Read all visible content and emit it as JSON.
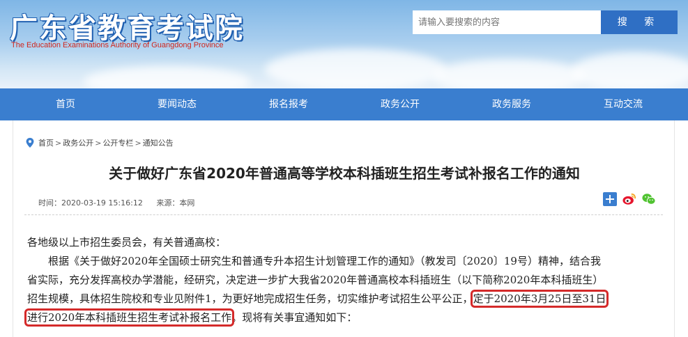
{
  "header": {
    "title_cn": "广东省教育考试院",
    "title_en": "The Education Examinations Authority of Guangdong Province",
    "search_placeholder": "请输入要搜索的内容",
    "search_button": "搜 索"
  },
  "nav": {
    "items": [
      "首页",
      "要闻动态",
      "报名报考",
      "政务公开",
      "政务服务",
      "互动交流"
    ]
  },
  "breadcrumb": {
    "items": [
      "首页",
      "政务公开",
      "公开专栏",
      "通知公告"
    ],
    "separator": ">"
  },
  "article": {
    "title": "关于做好广东省2020年普通高等学校本科插班生招生考试补报名工作的通知",
    "time": "时间：2020-03-19 15:16:12",
    "source": "来源：本网",
    "salutation": "各地级以上市招生委员会，有关普通高校：",
    "line1": "根据《关于做好2020年全国硕士研究生和普通专升本招生计划管理工作的通知》（教发司〔2020〕19号）精神，结合我",
    "line2": "省实际，充分发挥高校办学潜能，经研究，决定进一步扩大我省2020年普通高校本科插班生（以下简称2020年本科插班生）",
    "line3_a": "招生规模，具体招生院校和专业见附件1，为更好地完成招生任务，切实维护考试招生公平公正，",
    "line3_hl": "定于2020年3月25日至31日",
    "line4_hl": "进行2020年本科插班生招生考试补报名工作",
    "line4_b": "。现将有关事宜通知如下："
  },
  "colors": {
    "nav_bg": "#3a7ecf",
    "search_button_bg": "#2f6fc4",
    "highlight_box": "#d42a2a",
    "title_en_color": "#d0261d"
  }
}
